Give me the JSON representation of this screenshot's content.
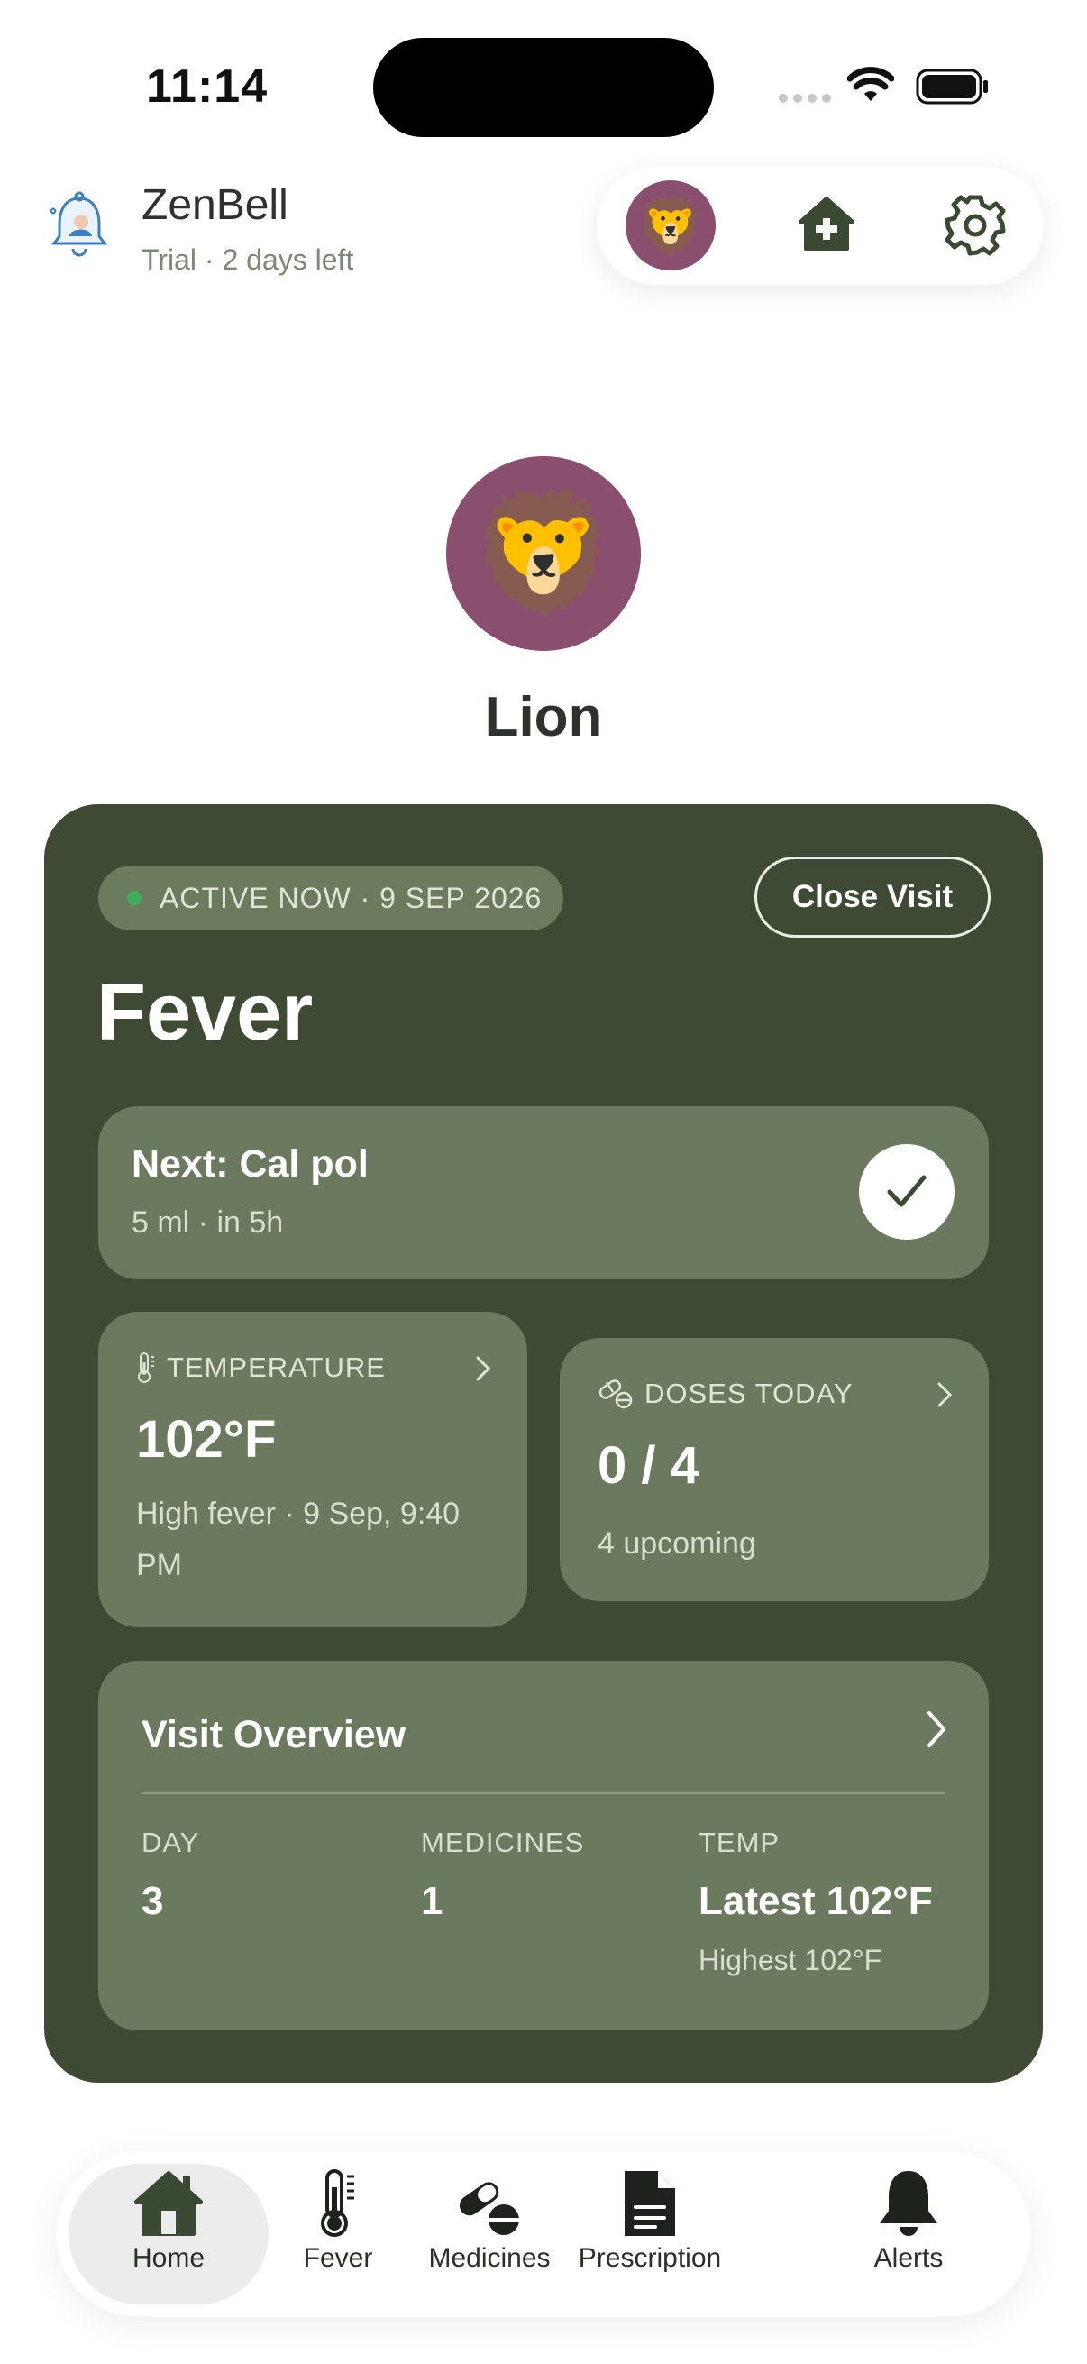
{
  "status": {
    "time": "11:14"
  },
  "header": {
    "app_name": "ZenBell",
    "subtitle": "Trial · 2 days left",
    "avatar_emoji": "🦁"
  },
  "profile": {
    "emoji": "🦁",
    "name": "Lion",
    "avatar_color": "#8a4f6e"
  },
  "visit": {
    "status_text": "ACTIVE NOW · 9 SEP 2026",
    "close_label": "Close Visit",
    "title": "Fever",
    "next": {
      "title": "Next: Cal pol",
      "subtitle": "5 ml · in 5h"
    },
    "temperature": {
      "label": "TEMPERATURE",
      "value": "102°F",
      "subtitle": "High fever · 9 Sep, 9:40 PM"
    },
    "doses": {
      "label": "DOSES TODAY",
      "value": "0 / 4",
      "subtitle": "4 upcoming"
    },
    "overview": {
      "title": "Visit Overview",
      "day_label": "DAY",
      "day_value": "3",
      "medicines_label": "MEDICINES",
      "medicines_value": "1",
      "temp_label": "TEMP",
      "temp_latest": "Latest 102°F",
      "temp_highest": "Highest 102°F"
    }
  },
  "nav": {
    "items": [
      {
        "label": "Home",
        "icon": "home-icon",
        "active": true
      },
      {
        "label": "Fever",
        "icon": "thermometer-icon"
      },
      {
        "label": "Medicines",
        "icon": "pills-icon"
      },
      {
        "label": "Prescription",
        "icon": "document-icon"
      },
      {
        "label": "Alerts",
        "icon": "bell-icon"
      }
    ]
  },
  "colors": {
    "card_bg": "#3e4a34",
    "tile_bg": "#6b7a5e",
    "active_dot": "#3fae5a"
  }
}
